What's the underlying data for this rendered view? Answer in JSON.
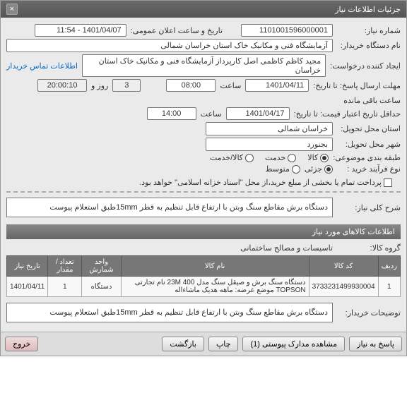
{
  "window_title": "جزئیات اطلاعات نیاز",
  "labels": {
    "need_no": "شماره نیاز:",
    "ann_datetime": "تاریخ و ساعت اعلان عمومی:",
    "buyer_org": "نام دستگاه خریدار:",
    "requester": "ایجاد کننده درخواست:",
    "send_deadline": "مهلت ارسال پاسخ: تا تاریخ:",
    "hour": "ساعت",
    "days_and": "روز و",
    "remaining": "ساعت باقی مانده",
    "price_valid": "حداقل تاریخ اعتبار قیمت: تا تاریخ:",
    "province": "استان محل تحویل:",
    "city": "شهر محل تحویل:",
    "subject_cat": "طبقه بندی موضوعی:",
    "buy_process": "نوع فرآیند خرید :",
    "need_desc": "شرح کلی نیاز:",
    "goods_info": "اطلاعات كالاهای مورد نیاز",
    "goods_group": "گروه کالا:",
    "buyer_notes": "توضیحات خریدار:",
    "contact_link": "اطلاعات تماس خریدار"
  },
  "values": {
    "need_no": "1101001596000001",
    "ann_datetime": "1401/04/07 - 11:54",
    "buyer_org": "آزمایشگاه فنی و مکانیک خاک استان خراسان شمالی",
    "requester": "مجید  کاظم  کاظمی اصل  کارپرداز آزمایشگاه فنی و مکانیک خاک استان خراسان",
    "deadline_date": "1401/04/11",
    "deadline_time": "08:00",
    "days_left": "3",
    "time_left": "20:00:10",
    "valid_date": "1401/04/17",
    "valid_time": "14:00",
    "province": "خراسان شمالی",
    "city": "بجنورد",
    "need_desc": "دستگاه برش مقاطع سنگ وبتن با ارتفاع قابل تنظیم به قطر 15mmطبق استعلام پیوست",
    "goods_group": "تاسیسات و مصالح ساختمانی",
    "buyer_notes": "دستگاه برش مقاطع سنگ وبتن با ارتفاع قابل تنظیم به قطر 15mmطبق استعلام پیوست"
  },
  "subject_options": [
    "کالا",
    "خدمت",
    "کالا/خدمت"
  ],
  "buy_options": {
    "opt1": "جزئی",
    "opt2": "متوسط",
    "checkbox_label": "پرداخت تمام یا بخشی از مبلغ خرید،از محل \"اسناد خزانه اسلامی\" خواهد بود."
  },
  "table": {
    "headers": [
      "ردیف",
      "کد کالا",
      "نام کالا",
      "واحد شمارش",
      "تعداد / مقدار",
      "تاریخ نیاز"
    ],
    "rows": [
      {
        "idx": "1",
        "code": "3733231499930004",
        "name": "دستگاه سنگ برش و صیقل سنگ مدل 400 23M نام تجارتی TOPSON موضع عرضه: ماهه هدیک ماشاءاله",
        "unit": "دستگاه",
        "qty": "1",
        "date": "1401/04/11"
      }
    ]
  },
  "buttons": {
    "reply": "پاسخ به نیاز",
    "attachments": "مشاهده مدارک پیوستی (1)",
    "print": "چاپ",
    "back": "بازگشت",
    "exit": "خروج"
  }
}
